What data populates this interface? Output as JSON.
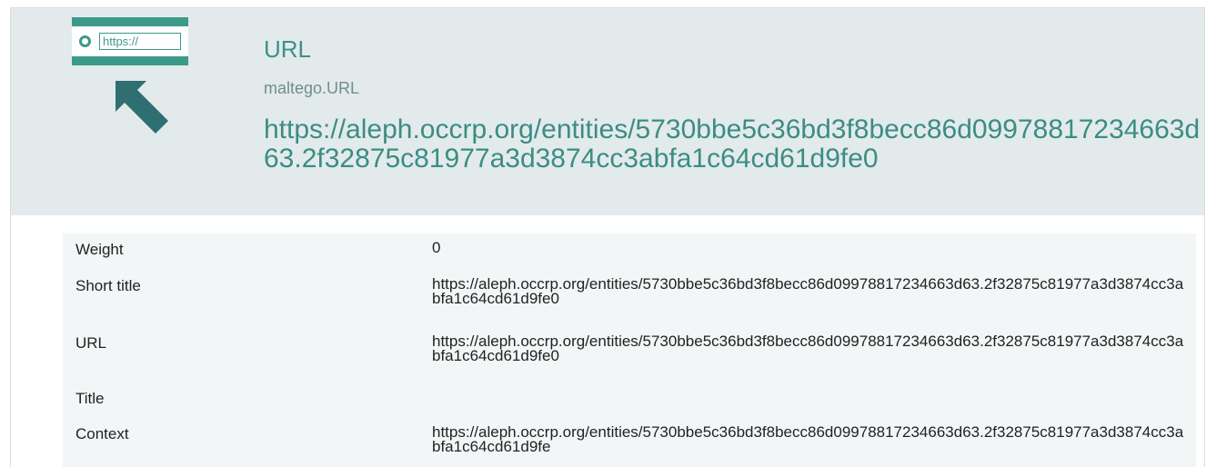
{
  "header": {
    "badge_text": "https://",
    "icons": [
      "url-badge-icon",
      "arrow-up-left-icon"
    ],
    "type_name": "URL",
    "type_id": "maltego.URL",
    "value": "https://aleph.occrp.org/entities/5730bbe5c36bd3f8becc86d09978817234663d63.2f32875c81977a3d3874cc3abfa1c64cd61d9fe0"
  },
  "properties": [
    {
      "label": "Weight",
      "value": "0"
    },
    {
      "label": "Short title",
      "value": "https://aleph.occrp.org/entities/5730bbe5c36bd3f8becc86d09978817234663d63.2f32875c81977a3d3874cc3abfa1c64cd61d9fe0"
    },
    {
      "label": "URL",
      "value": "https://aleph.occrp.org/entities/5730bbe5c36bd3f8becc86d09978817234663d63.2f32875c81977a3d3874cc3abfa1c64cd61d9fe0"
    },
    {
      "label": "Title",
      "value": ""
    },
    {
      "label": "Context",
      "value": "https://aleph.occrp.org/entities/5730bbe5c36bd3f8becc86d09978817234663d63.2f32875c81977a3d3874cc3abfa1c64cd61d9fe"
    }
  ],
  "colors": {
    "accent": "#3c9a8a",
    "header_bg": "#e3eaec",
    "table_bg": "#f3f6f7",
    "arrow": "#2f6f71"
  }
}
